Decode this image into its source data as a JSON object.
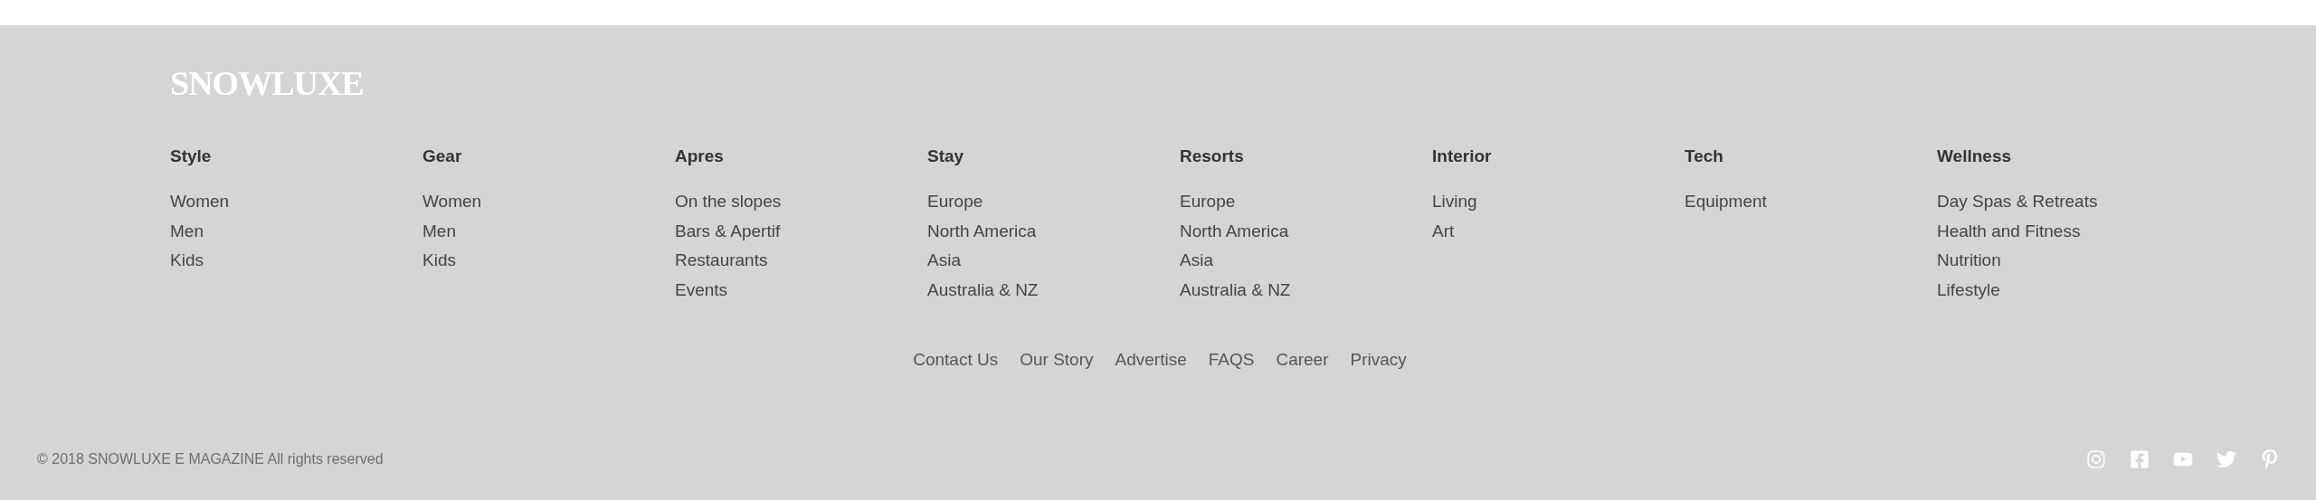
{
  "logo": "SNOWLUXE",
  "columns": [
    {
      "heading": "Style",
      "links": [
        "Women",
        "Men",
        "Kids"
      ]
    },
    {
      "heading": "Gear",
      "links": [
        "Women",
        "Men",
        "Kids"
      ]
    },
    {
      "heading": "Apres",
      "links": [
        "On the slopes",
        "Bars & Apertif",
        "Restaurants",
        "Events"
      ]
    },
    {
      "heading": "Stay",
      "links": [
        "Europe",
        "North America",
        "Asia",
        "Australia & NZ"
      ]
    },
    {
      "heading": "Resorts",
      "links": [
        "Europe",
        "North America",
        "Asia",
        "Australia & NZ"
      ]
    },
    {
      "heading": "Interior",
      "links": [
        "Living",
        "Art"
      ]
    },
    {
      "heading": "Tech",
      "links": [
        "Equipment"
      ]
    },
    {
      "heading": "Wellness",
      "links": [
        "Day Spas & Retreats",
        "Health and Fitness",
        "Nutrition",
        "Lifestyle"
      ]
    }
  ],
  "bottom_links": [
    "Contact Us",
    "Our Story",
    "Advertise",
    "FAQS",
    "Career",
    "Privacy"
  ],
  "copyright": "© 2018 SNOWLUXE E MAGAZINE All rights reserved",
  "social": [
    {
      "kind": "instagram"
    },
    {
      "kind": "facebook"
    },
    {
      "kind": "youtube"
    },
    {
      "kind": "twitter"
    },
    {
      "kind": "pinterest"
    }
  ]
}
